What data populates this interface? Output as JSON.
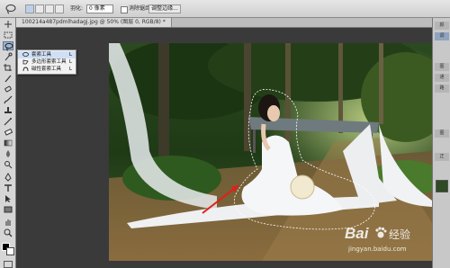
{
  "document_tab": {
    "title": "100214a487pdmlhadagj.jpg @ 50% (图层 0, RGB/8) *"
  },
  "options_bar": {
    "feather_label": "羽化:",
    "feather_value": "0 像素",
    "antialias_label": "消除锯齿",
    "refine_edge_label": "调整边缘..."
  },
  "lasso_flyout": {
    "items": [
      {
        "label": "套索工具",
        "shortcut": "L",
        "icon": "lasso-icon",
        "selected": true
      },
      {
        "label": "多边形套索工具",
        "shortcut": "L",
        "icon": "polygonal-lasso-icon",
        "selected": false
      },
      {
        "label": "磁性套索工具",
        "shortcut": "L",
        "icon": "magnetic-lasso-icon",
        "selected": false
      }
    ]
  },
  "tools": [
    "move-tool-icon",
    "marquee-tool-icon",
    "lasso-tool-icon",
    "quick-select-icon",
    "crop-tool-icon",
    "eyedropper-icon",
    "healing-brush-icon",
    "brush-tool-icon",
    "clone-stamp-icon",
    "history-brush-icon",
    "eraser-icon",
    "gradient-tool-icon",
    "blur-tool-icon",
    "dodge-tool-icon",
    "pen-tool-icon",
    "type-tool-icon",
    "path-select-icon",
    "shape-tool-icon",
    "hand-tool-icon",
    "zoom-tool-icon"
  ],
  "right_panel": {
    "tabs": [
      "颜",
      "调",
      "图",
      "通",
      "路",
      "图",
      "正"
    ]
  },
  "watermark": {
    "brand": "Bai",
    "brand_suffix": "经验",
    "url": "jingyan.baidu.com"
  },
  "colors": {
    "ui_gray": "#d6d6d6",
    "canvas_bg": "#3a3a3a",
    "flyout_highlight": "#cfe0f5",
    "arrow_red": "#e0201a"
  }
}
